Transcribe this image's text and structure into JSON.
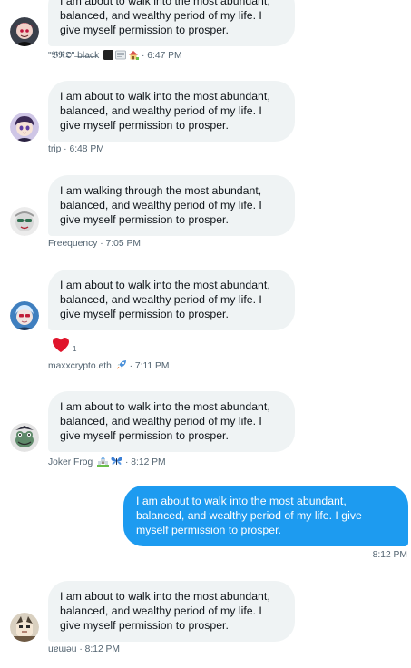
{
  "messages": [
    {
      "text": "I am about to walk into the most abundant, balanced, and wealthy period of my life. I give myself permission to prosper.",
      "sender": "\"𝕭𝕽𝕺\" ̶b̶l̶a̶c̶k",
      "time": "6:47 PM"
    },
    {
      "text": "I am about to walk into the most abundant, balanced, and wealthy period of my life. I give myself permission to prosper.",
      "sender": "trip",
      "time": "6:48 PM"
    },
    {
      "text": "I am walking through the most abundant, balanced, and wealthy period of my life. I give myself permission to prosper.",
      "sender": "Freequency",
      "time": "7:05 PM"
    },
    {
      "text": "I am about to walk into the most abundant, balanced, and wealthy period of my life. I give myself permission to prosper.",
      "sender": "maxxcrypto.eth",
      "time": "7:11 PM",
      "reaction": {
        "icon": "heart-icon",
        "count": "1",
        "color": "#f4212e"
      }
    },
    {
      "text": "I am about to walk into the most abundant, balanced, and wealthy period of my life. I give myself permission to prosper.",
      "sender": "Joker Frog",
      "time": "8:12 PM"
    },
    {
      "text": "I am about to walk into the most abundant, balanced, and wealthy period of my life. I give myself permission to prosper.",
      "time": "8:12 PM",
      "mine": true,
      "color": "#1d9bf0"
    },
    {
      "text": "I am about to walk into the most abundant, balanced, and wealthy period of my life. I give myself permission to prosper.",
      "sender": "uɐɯǝu",
      "time": "8:12 PM"
    }
  ],
  "separator": " · ",
  "colors": {
    "bubble_incoming": "#eff3f4",
    "bubble_outgoing": "#1d9bf0",
    "meta_text": "#536471"
  }
}
